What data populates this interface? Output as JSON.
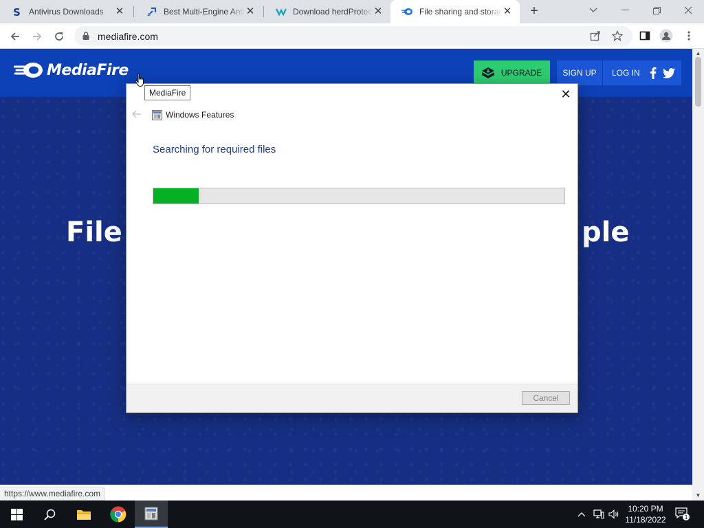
{
  "browser": {
    "tabs": [
      {
        "title": "Antivirus Downloads",
        "icon": "softpedia-icon",
        "active": false
      },
      {
        "title": "Best Multi-Engine Antivirus",
        "icon": "wrench-site-icon",
        "active": false
      },
      {
        "title": "Download herdProtect",
        "icon": "herdprotect-icon",
        "active": false
      },
      {
        "title": "File sharing and storage",
        "icon": "mediafire-icon",
        "active": true
      }
    ],
    "address": "mediafire.com",
    "status_url": "https://www.mediafire.com"
  },
  "mediafire": {
    "brand": "MediaFire",
    "upgrade_label": "UPGRADE",
    "signup_label": "SIGN UP",
    "login_label": "LOG IN",
    "hero_left": "File",
    "hero_right": "ple",
    "accent": "#2ecc71",
    "header_color": "#0d41b7"
  },
  "tooltip": {
    "text": "MediaFire"
  },
  "dialog": {
    "title": "Windows Features",
    "heading": "Searching for required files",
    "progress": 0.11,
    "cancel_label": "Cancel",
    "progress_color": "#06b025"
  },
  "taskbar": {
    "time": "10:20 PM",
    "date": "11/18/2022",
    "notification_count": "1"
  }
}
